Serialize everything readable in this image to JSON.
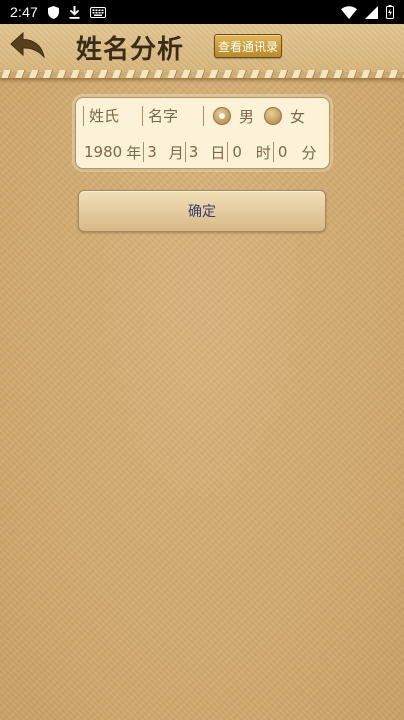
{
  "status_bar": {
    "time": "2:47",
    "icons": [
      "shield-icon",
      "download-icon",
      "keyboard-icon",
      "wifi-icon",
      "signal-icon",
      "battery-icon"
    ]
  },
  "header": {
    "title": "姓名分析",
    "contacts_button": "查看通讯录",
    "back_icon": "back-arrow-icon"
  },
  "form": {
    "surname_placeholder": "姓氏",
    "given_name_placeholder": "名字",
    "gender_options": [
      {
        "label": "男",
        "selected": true
      },
      {
        "label": "女",
        "selected": false
      }
    ],
    "birth": {
      "year": "1980",
      "year_unit": "年",
      "month": "3",
      "month_unit": "月",
      "day": "3",
      "day_unit": "日",
      "hour": "0",
      "hour_unit": "时",
      "minute": "0",
      "minute_unit": "分"
    }
  },
  "confirm_button": "确定",
  "colors": {
    "background": "#d4ad73",
    "title_text": "#3b2c1a",
    "contacts_button": "#c89b35",
    "card": "#fbf2d7",
    "confirm_text": "#3d3a6e"
  }
}
